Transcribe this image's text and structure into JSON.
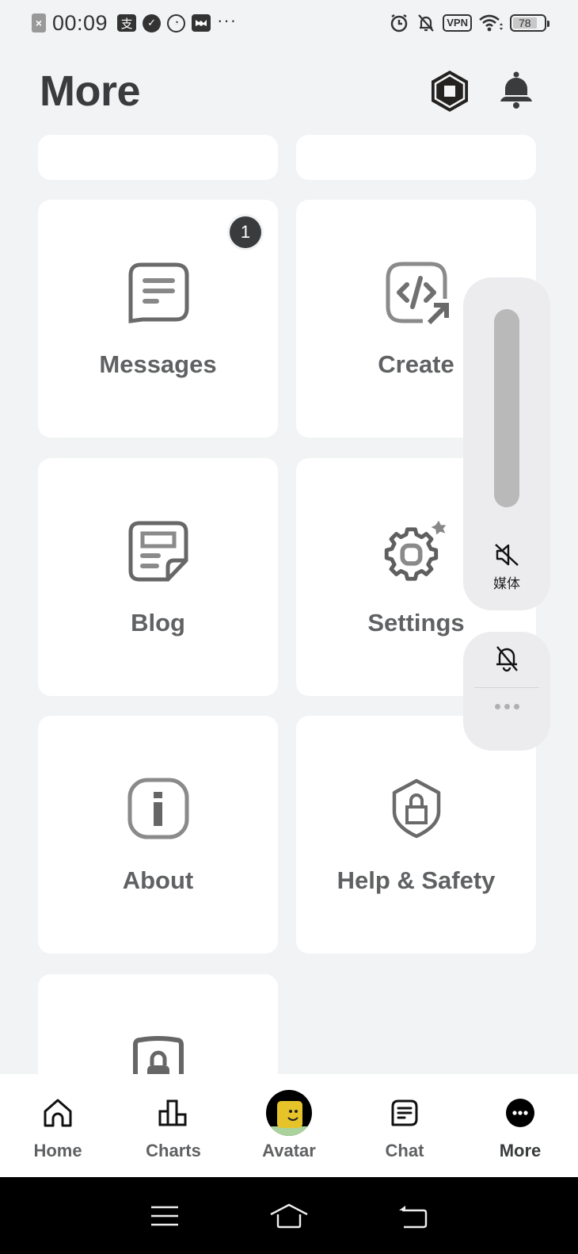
{
  "status_bar": {
    "time": "00:09",
    "left_icons": [
      "sim-off-icon",
      "alipay-icon",
      "check-circle-icon",
      "speed-icon",
      "app-icon",
      "more-dots-icon"
    ],
    "right_icons": [
      "alarm-icon",
      "bell-off-icon",
      "vpn-icon",
      "wifi-icon",
      "battery-icon"
    ],
    "vpn_label": "VPN",
    "battery_level": "78"
  },
  "header": {
    "title": "More",
    "robux_icon": "robux-icon",
    "notification_icon": "bell-icon"
  },
  "grid": {
    "items": [
      {
        "label": "",
        "icon": ""
      },
      {
        "label": "",
        "icon": ""
      },
      {
        "label": "Messages",
        "icon": "messages-icon",
        "badge": "1"
      },
      {
        "label": "Create",
        "icon": "create-icon"
      },
      {
        "label": "Blog",
        "icon": "blog-icon"
      },
      {
        "label": "Settings",
        "icon": "settings-icon"
      },
      {
        "label": "About",
        "icon": "about-icon"
      },
      {
        "label": "Help & Safety",
        "icon": "help-safety-icon"
      },
      {
        "label": "",
        "icon": "parental-lock-icon"
      }
    ]
  },
  "volume_overlay": {
    "media_label": "媒体",
    "volume_level": 0,
    "mute_icon": "speaker-muted-icon",
    "ring_icon": "bell-off-icon",
    "more_icon": "more-dots-icon"
  },
  "bottom_nav": {
    "items": [
      {
        "label": "Home",
        "icon": "home-icon"
      },
      {
        "label": "Charts",
        "icon": "charts-icon"
      },
      {
        "label": "Avatar",
        "icon": "avatar-icon"
      },
      {
        "label": "Chat",
        "icon": "chat-icon"
      },
      {
        "label": "More",
        "icon": "more-icon",
        "active": true
      }
    ]
  },
  "system_nav": {
    "buttons": [
      "menu-icon",
      "home-icon",
      "back-icon"
    ]
  }
}
